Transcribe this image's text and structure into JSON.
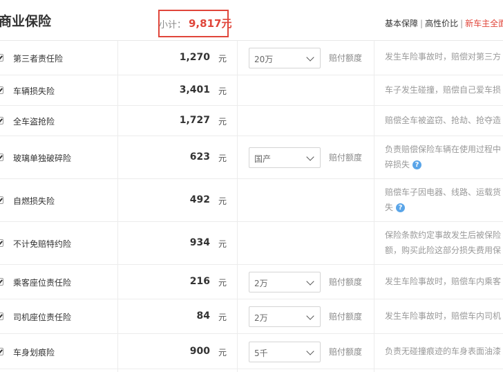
{
  "header": {
    "title": "商业保险",
    "subtotal_label": "小计：",
    "subtotal_value": "9,817元",
    "links": [
      "基本保障",
      "高性价比",
      "新车主全面"
    ]
  },
  "unit": "元",
  "rows": [
    {
      "name": "第三者责任险",
      "price": "1,270",
      "select": "20万",
      "select_label": "赔付额度",
      "desc": [
        "发生车险事故时，赔偿对第三方"
      ]
    },
    {
      "name": "车辆损失险",
      "price": "3,401",
      "select": null,
      "select_label": "",
      "desc": [
        "车子发生碰撞，赔偿自己爱车损"
      ]
    },
    {
      "name": "全车盗抢险",
      "price": "1,727",
      "select": null,
      "select_label": "",
      "desc": [
        "赔偿全车被盗窃、抢劫、抢夺造"
      ]
    },
    {
      "name": "玻璃单独破碎险",
      "price": "623",
      "select": "国产",
      "select_label": "赔付额度",
      "desc": [
        "负责赔偿保险车辆在使用过程中",
        "碎损失"
      ],
      "help": true
    },
    {
      "name": "自燃损失险",
      "price": "492",
      "select": null,
      "select_label": "",
      "desc": [
        "赔偿车子因电器、线路、运载货",
        "失"
      ],
      "help": true
    },
    {
      "name": "不计免赔特约险",
      "price": "934",
      "select": null,
      "select_label": "",
      "desc": [
        "保险条款约定事故发生后被保险",
        "额，购买此险这部分损失费用保"
      ]
    },
    {
      "name": "乘客座位责任险",
      "price": "216",
      "select": "2万",
      "select_label": "赔付额度",
      "desc": [
        "发生车险事故时，赔偿车内乘客"
      ]
    },
    {
      "name": "司机座位责任险",
      "price": "84",
      "select": "2万",
      "select_label": "赔付额度",
      "desc": [
        "发生车险事故时，赔偿车内司机"
      ]
    },
    {
      "name": "车身划痕险",
      "price": "900",
      "select": "5千",
      "select_label": "赔付额度",
      "desc": [
        "负责无碰撞痕迹的车身表面油漆"
      ]
    }
  ]
}
